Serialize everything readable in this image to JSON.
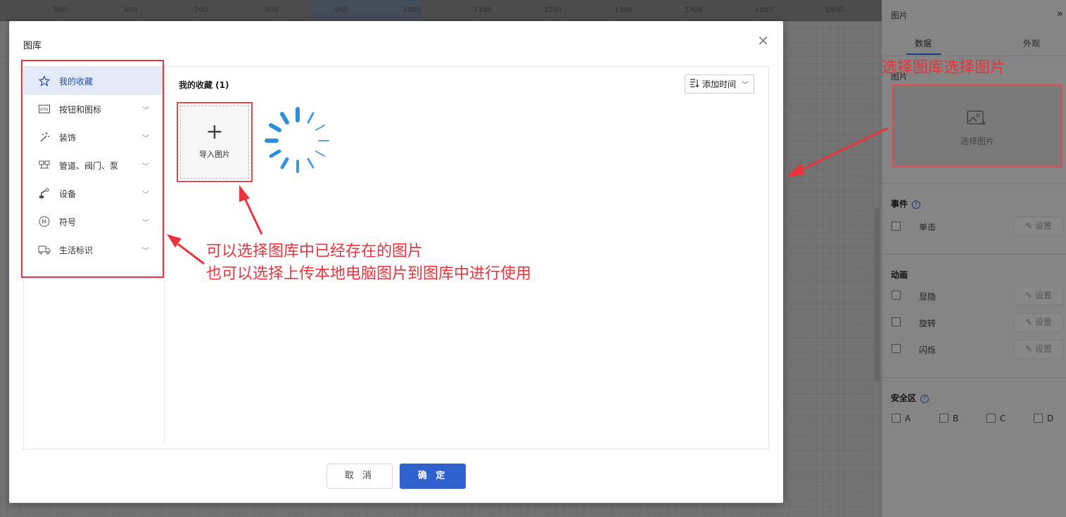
{
  "ruler": {
    "ticks": [
      "500",
      "600",
      "700",
      "800",
      "900",
      "1000",
      "1100",
      "1200",
      "1300",
      "1400",
      "1500",
      "1600"
    ]
  },
  "dialog": {
    "title": "图库",
    "sidebar": [
      {
        "label": "我的收藏",
        "icon": "star-icon",
        "active": true,
        "expandable": false
      },
      {
        "label": "按钮和图标",
        "icon": "btn-icon",
        "expandable": true
      },
      {
        "label": "装饰",
        "icon": "magic-wand-icon",
        "expandable": true
      },
      {
        "label": "管道、阀门、泵",
        "icon": "pipe-icon",
        "expandable": true
      },
      {
        "label": "设备",
        "icon": "robot-arm-icon",
        "expandable": true
      },
      {
        "label": "符号",
        "icon": "m-circle-icon",
        "expandable": true
      },
      {
        "label": "生活标识",
        "icon": "truck-icon",
        "expandable": true
      }
    ],
    "main_title": "我的收藏 (1)",
    "sort_label": "添加时间",
    "import_label": "导入图片",
    "cancel_label": "取 消",
    "ok_label": "确 定"
  },
  "right_panel": {
    "header": "图片",
    "tabs": [
      "数据",
      "外观"
    ],
    "image_section": "图片",
    "choose_image_label": "选择图片",
    "event_section": "事件",
    "events": [
      {
        "label": "单击",
        "button": "设置"
      }
    ],
    "animation_section": "动画",
    "animations": [
      {
        "label": "显隐",
        "button": "设置"
      },
      {
        "label": "旋转",
        "button": "设置"
      },
      {
        "label": "闪烁",
        "button": "设置"
      }
    ],
    "safe_section": "安全区",
    "safe_options": [
      "A",
      "B",
      "C",
      "D"
    ]
  },
  "annotations": {
    "top_right": "选择图库选择图片",
    "middle_line1": "可以选择图库中已经存在的图片",
    "middle_line2": "也可以选择上传本地电脑图片到图库中进行使用"
  }
}
